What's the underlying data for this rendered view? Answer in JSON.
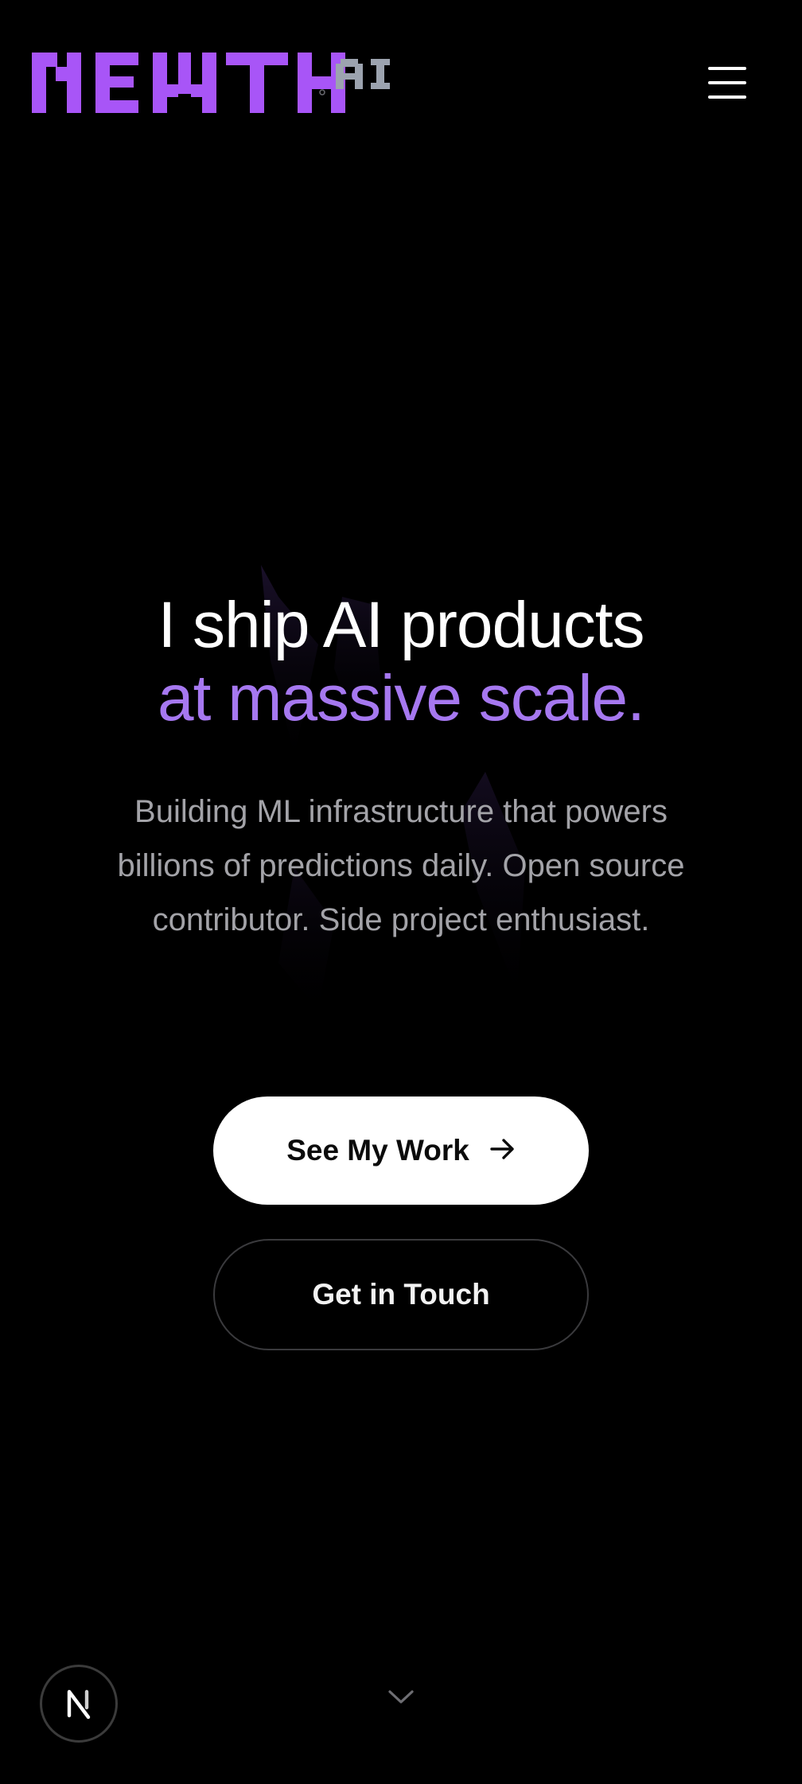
{
  "header": {
    "logo": {
      "wordmark": "NEWTH",
      "suffix": "AI",
      "separator": "°",
      "wordmark_color": "#a855f7",
      "suffix_color": "#9ca3af"
    },
    "menu_icon": "hamburger-menu-icon"
  },
  "hero": {
    "headline_line1": "I ship AI products",
    "headline_line2": "at massive scale.",
    "subtitle": "Building ML infrastructure that powers billions of predictions daily. Open source contributor. Side project enthusiast.",
    "accent_color": "#a678f0"
  },
  "actions": {
    "primary_label": "See My Work",
    "primary_icon": "arrow-right-icon",
    "secondary_label": "Get in Touch"
  },
  "footer": {
    "scroll_icon": "chevron-down-icon",
    "badge_letter": "N",
    "badge_icon": "nextjs-badge-icon"
  }
}
